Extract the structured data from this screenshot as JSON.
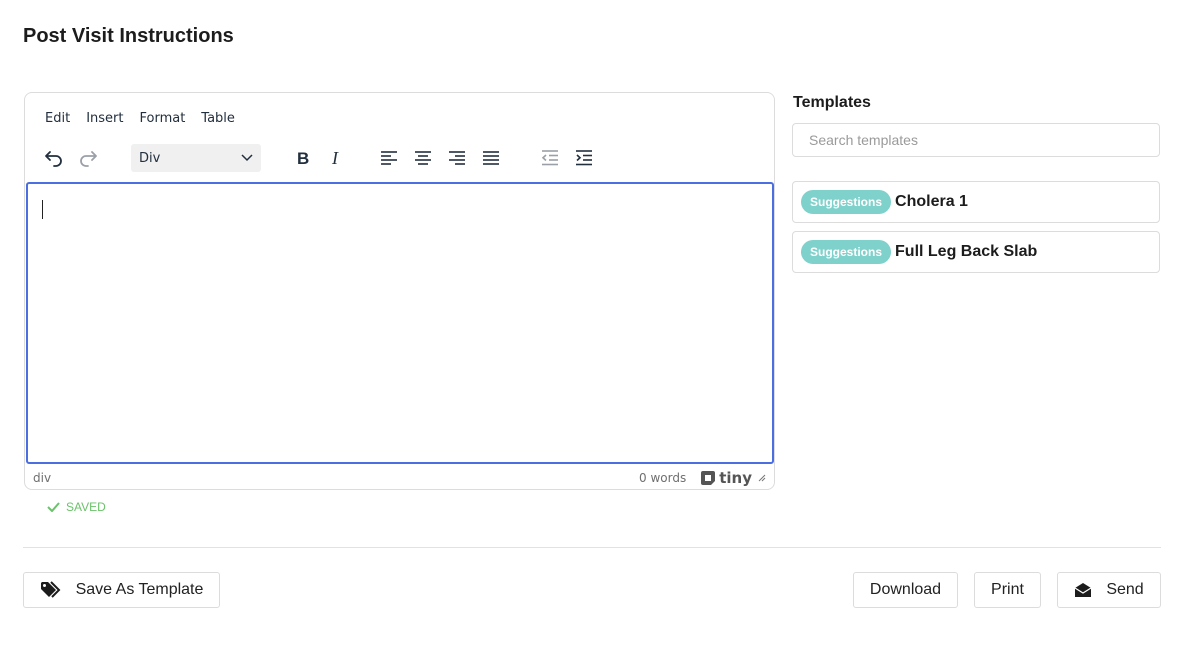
{
  "page_title": "Post Visit Instructions",
  "editor": {
    "menu": [
      "Edit",
      "Insert",
      "Format",
      "Table"
    ],
    "block_format": "Div",
    "icons": {
      "undo": "undo-icon",
      "redo": "redo-icon",
      "bold": "bold-icon",
      "italic": "italic-icon",
      "align_left": "align-left-icon",
      "align_center": "align-center-icon",
      "align_right": "align-right-icon",
      "justify": "justify-icon",
      "outdent": "outdent-icon",
      "indent": "indent-icon"
    },
    "status_path": "div",
    "word_count": "0 words",
    "brand": "tiny"
  },
  "saved_status": "SAVED",
  "templates": {
    "title": "Templates",
    "search_placeholder": "Search templates",
    "items": [
      {
        "badge": "Suggestions",
        "name": "Cholera 1"
      },
      {
        "badge": "Suggestions",
        "name": "Full Leg Back Slab"
      }
    ]
  },
  "actions": {
    "save_template": "Save As Template",
    "download": "Download",
    "print": "Print",
    "send": "Send"
  },
  "colors": {
    "editor_focus_border": "#4b6ee0",
    "badge_bg": "#7fd1cb",
    "saved_green": "#6ac26a"
  }
}
